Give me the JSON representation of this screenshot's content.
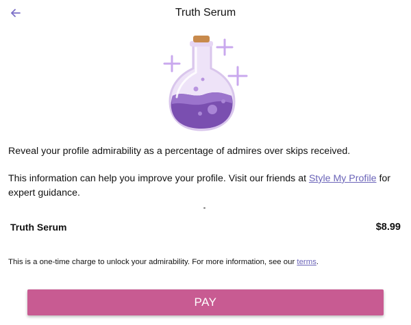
{
  "header": {
    "back_icon": "arrow-left-icon",
    "title": "Truth Serum"
  },
  "illustration": {
    "icon": "potion-flask-icon",
    "colors": {
      "flask_glass": "#d9c6ec",
      "potion": "#7a4fb0",
      "potion_light": "#a985d6",
      "cork": "#c88a4c",
      "sparkle": "#c9a8ee"
    }
  },
  "description": {
    "line1": "Reveal your profile admirability as a percentage of admires over skips received.",
    "line2_before": "This information can help you improve your profile. Visit our friends at ",
    "line2_link": "Style My Profile",
    "line2_after": " for expert guidance."
  },
  "purchase": {
    "item_name": "Truth Serum",
    "price": "$8.99"
  },
  "note": {
    "text_before": "This is a one-time charge to unlock your admirability. For more information, see our ",
    "link": "terms",
    "text_after": "."
  },
  "actions": {
    "pay_label": "PAY"
  },
  "colors": {
    "accent": "#7b6fc7",
    "link": "#6a63b8",
    "pay_button": "#c85b92"
  }
}
